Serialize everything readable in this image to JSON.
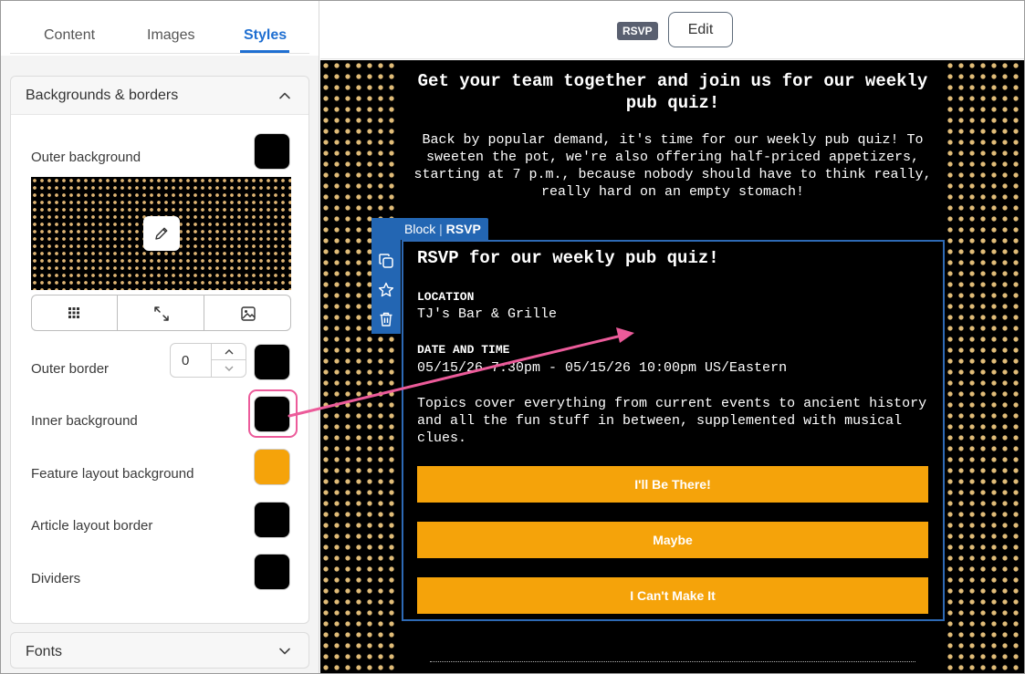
{
  "tabs": [
    {
      "label": "Content",
      "active": false
    },
    {
      "label": "Images",
      "active": false
    },
    {
      "label": "Styles",
      "active": true
    }
  ],
  "panel": {
    "section_title": "Backgrounds & borders",
    "rows": {
      "outer_background": {
        "label": "Outer background",
        "color": "#000000"
      },
      "outer_border": {
        "label": "Outer border",
        "width_value": "0",
        "color": "#000000"
      },
      "inner_background": {
        "label": "Inner background",
        "color": "#000000"
      },
      "feature_layout_background": {
        "label": "Feature layout background",
        "color": "#f5a30a"
      },
      "article_layout_border": {
        "label": "Article layout border",
        "color": "#000000"
      },
      "dividers": {
        "label": "Dividers",
        "color": "#000000"
      }
    },
    "image_options": [
      "grid-icon",
      "resize-icon",
      "image-icon"
    ],
    "fonts_title": "Fonts"
  },
  "topbar": {
    "badge": "RSVP",
    "edit_label": "Edit"
  },
  "email": {
    "headline": "Get your team together and join us for our weekly pub quiz!",
    "intro": "Back by popular demand, it's time for our weekly pub quiz! To sweeten the pot, we're also offering half-priced appetizers, starting at 7 p.m., because nobody should have to think really, really hard on an empty stomach!",
    "block_tag": {
      "label": "Block",
      "type": "RSVP"
    },
    "rsvp_title": "RSVP for our weekly pub quiz!",
    "location_label": "LOCATION",
    "location": "TJ's Bar & Grille",
    "datetime_label": "DATE AND TIME",
    "datetime": "05/15/26 7:30pm - 05/15/26 10:00pm US/Eastern",
    "description": "Topics cover everything from current events to ancient history and all the fun stuff in between, supplemented with musical clues.",
    "buttons": [
      "I'll Be There!",
      "Maybe",
      "I Can't Make It"
    ]
  },
  "colors": {
    "accent": "#1f6fd1",
    "button": "#f5a30a",
    "block_outline": "#2366b3",
    "annotation": "#ec5b9a"
  }
}
